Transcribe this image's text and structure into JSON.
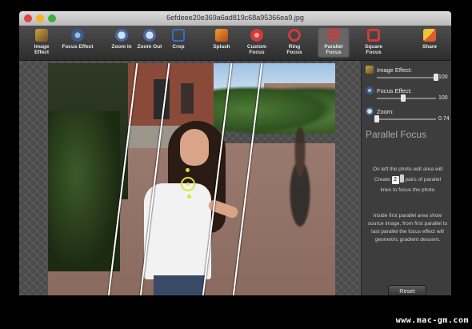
{
  "window": {
    "title": "6efdeee20e369a6ad819c68a95366ea9.jpg"
  },
  "toolbar": {
    "items": [
      {
        "label": "Image Effect",
        "icon": "brush-icon",
        "color": "#8a6d3b"
      },
      {
        "label": "Focus Effect",
        "icon": "lens-icon",
        "color": "#3d5a8a"
      },
      {
        "label": "Zoom In",
        "icon": "zoom-in-icon",
        "color": "#4a6aa0"
      },
      {
        "label": "Zoom Out",
        "icon": "zoom-out-icon",
        "color": "#4a6aa0"
      },
      {
        "label": "Crop",
        "icon": "crop-icon",
        "color": "#3a6acc"
      },
      {
        "label": "Splash",
        "icon": "splash-icon",
        "color": "#e07a2a"
      },
      {
        "label": "Custom Focus",
        "icon": "custom-focus-icon",
        "color": "#d23a3a"
      },
      {
        "label": "Ring Focus",
        "icon": "ring-focus-icon",
        "color": "#d23a3a"
      },
      {
        "label": "Parallel Focus",
        "icon": "parallel-focus-icon",
        "color": "#d23a3a",
        "active": true
      },
      {
        "label": "Square Focus",
        "icon": "square-focus-icon",
        "color": "#d23a3a"
      },
      {
        "label": "Share",
        "icon": "share-icon",
        "color": "#e05a2a"
      }
    ]
  },
  "panel": {
    "image_effect": {
      "label": "Image Effect:",
      "value": "100",
      "fraction": 1.0
    },
    "focus_effect": {
      "label": "Focus Effect:",
      "value": "100",
      "fraction": 0.45
    },
    "zoom": {
      "label": "Zoom:",
      "value": "0.74",
      "fraction": 0.0
    },
    "heading": "Parallel Focus",
    "desc1_line1": "On left the photo edit area will",
    "desc1_create": "Create",
    "desc1_count": "2",
    "desc1_after": "pairs of parallel",
    "desc1_line3": "lines to focus the photo",
    "desc2": "Inside first parallel area show source image, from first parallel to last parallel the focus effect will geometric gradient descent.",
    "reset_label": "Reset"
  },
  "watermark": "www.mac-gm.com",
  "colors": {
    "accent": "#d8e83a",
    "panel_bg": "#3d3d3d"
  }
}
